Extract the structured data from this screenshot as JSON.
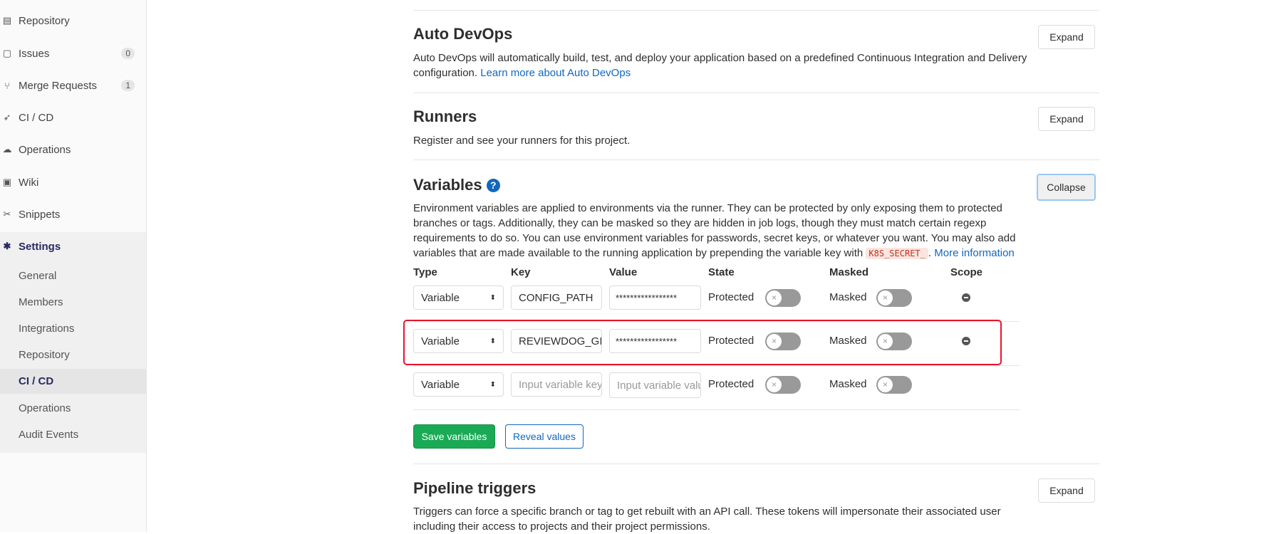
{
  "sidebar": {
    "items": [
      {
        "label": "Repository",
        "icon": "file-icon"
      },
      {
        "label": "Issues",
        "icon": "issues-icon",
        "badge": "0"
      },
      {
        "label": "Merge Requests",
        "icon": "merge-request-icon",
        "badge": "1"
      },
      {
        "label": "CI / CD",
        "icon": "rocket-icon"
      },
      {
        "label": "Operations",
        "icon": "cloud-gear-icon"
      },
      {
        "label": "Wiki",
        "icon": "book-icon"
      },
      {
        "label": "Snippets",
        "icon": "scissors-icon"
      },
      {
        "label": "Settings",
        "icon": "gear-icon"
      }
    ],
    "sub_items": [
      "General",
      "Members",
      "Integrations",
      "Repository",
      "CI / CD",
      "Operations",
      "Audit Events"
    ],
    "active_sub": "CI / CD",
    "accent": "#292961"
  },
  "auto_devops": {
    "title": "Auto DevOps",
    "desc": "Auto DevOps will automatically build, test, and deploy your application based on a predefined Continuous Integration and Delivery configuration.",
    "link": "Learn more about Auto DevOps",
    "button": "Expand"
  },
  "runners": {
    "title": "Runners",
    "desc": "Register and see your runners for this project.",
    "button": "Expand"
  },
  "variables": {
    "title": "Variables",
    "help_icon": "question-circle-icon",
    "button": "Collapse",
    "desc": "Environment variables are applied to environments via the runner. They can be protected by only exposing them to protected branches or tags. Additionally, they can be masked so they are hidden in job logs, though they must match certain regexp requirements to do so. You can use environment variables for passwords, secret keys, or whatever you want. You may also add variables that are made available to the running application by prepending the variable key with",
    "code": "K8S_SECRET_",
    "more": "More information",
    "headers": {
      "type": "Type",
      "key": "Key",
      "value": "Value",
      "state": "State",
      "masked": "Masked",
      "scope": "Scope"
    },
    "rows": [
      {
        "type": "Variable",
        "key": "CONFIG_PATH",
        "value": "*****************",
        "state": "Protected",
        "masked": "Masked",
        "protected_on": false,
        "masked_on": false
      },
      {
        "type": "Variable",
        "key": "REVIEWDOG_GI",
        "value": "*****************",
        "state": "Protected",
        "masked": "Masked",
        "protected_on": false,
        "masked_on": false
      },
      {
        "type": "Variable",
        "key_placeholder": "Input variable key",
        "value_placeholder": "Input variable value",
        "state": "Protected",
        "masked": "Masked",
        "protected_on": false,
        "masked_on": false
      }
    ],
    "save": "Save variables",
    "reveal": "Reveal values",
    "save_color": "#1aaa55",
    "highlight_color": "#e8132a"
  },
  "triggers": {
    "title": "Pipeline triggers",
    "desc": "Triggers can force a specific branch or tag to get rebuilt with an API call. These tokens will impersonate their associated user including their access to projects and their project permissions.",
    "button": "Expand"
  }
}
